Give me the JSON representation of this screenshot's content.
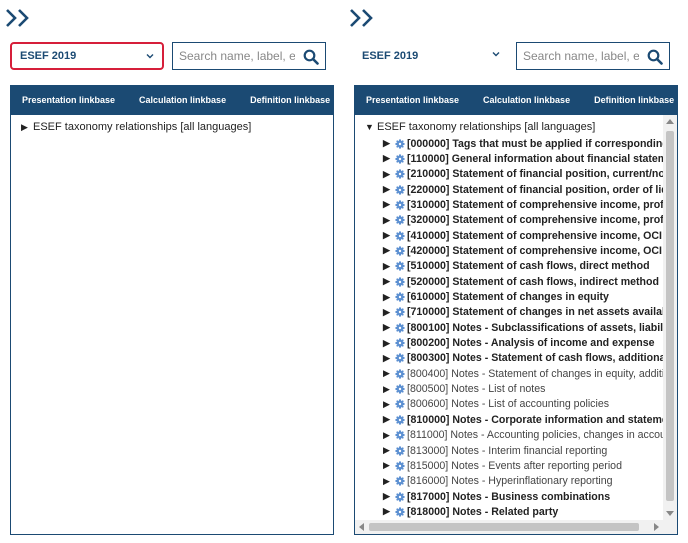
{
  "left_panel": {
    "select_value": "ESEF 2019",
    "search_placeholder": "Search name, label, etc.",
    "tabs": [
      "Presentation linkbase",
      "Calculation linkbase",
      "Definition linkbase"
    ],
    "root_label": "ESEF taxonomy relationships [all languages]"
  },
  "right_panel": {
    "select_value": "ESEF 2019",
    "search_placeholder": "Search name, label, etc.",
    "tabs": [
      "Presentation linkbase",
      "Calculation linkbase",
      "Definition linkbase"
    ],
    "root_label": "ESEF taxonomy relationships [all languages]",
    "nodes": [
      {
        "code": "[000000]",
        "label": "Tags that must be applied if corresponding in",
        "bold": true
      },
      {
        "code": "[110000]",
        "label": "General information about financial statemen",
        "bold": true
      },
      {
        "code": "[210000]",
        "label": "Statement of financial position, current/non-c",
        "bold": true
      },
      {
        "code": "[220000]",
        "label": "Statement of financial position, order of liquic",
        "bold": true
      },
      {
        "code": "[310000]",
        "label": "Statement of comprehensive income, profit o",
        "bold": true
      },
      {
        "code": "[320000]",
        "label": "Statement of comprehensive income, profit o",
        "bold": true
      },
      {
        "code": "[410000]",
        "label": "Statement of comprehensive income, OCI cor",
        "bold": true
      },
      {
        "code": "[420000]",
        "label": "Statement of comprehensive income, OCI cor",
        "bold": true
      },
      {
        "code": "[510000]",
        "label": "Statement of cash flows, direct method",
        "bold": true
      },
      {
        "code": "[520000]",
        "label": "Statement of cash flows, indirect method",
        "bold": true
      },
      {
        "code": "[610000]",
        "label": "Statement of changes in equity",
        "bold": true
      },
      {
        "code": "[710000]",
        "label": "Statement of changes in net assets available",
        "bold": true
      },
      {
        "code": "[800100]",
        "label": "Notes - Subclassifications of assets, liabilitie",
        "bold": true
      },
      {
        "code": "[800200]",
        "label": "Notes - Analysis of income and expense",
        "bold": true
      },
      {
        "code": "[800300]",
        "label": "Notes - Statement of cash flows, additional di",
        "bold": true
      },
      {
        "code": "[800400]",
        "label": "Notes - Statement of changes in equity, additiona",
        "bold": false
      },
      {
        "code": "[800500]",
        "label": "Notes - List of notes",
        "bold": false
      },
      {
        "code": "[800600]",
        "label": "Notes - List of accounting policies",
        "bold": false
      },
      {
        "code": "[810000]",
        "label": "Notes - Corporate information and statement",
        "bold": true
      },
      {
        "code": "[811000]",
        "label": "Notes - Accounting policies, changes in accountin",
        "bold": false
      },
      {
        "code": "[813000]",
        "label": "Notes - Interim financial reporting",
        "bold": false
      },
      {
        "code": "[815000]",
        "label": "Notes - Events after reporting period",
        "bold": false
      },
      {
        "code": "[816000]",
        "label": "Notes - Hyperinflationary reporting",
        "bold": false
      },
      {
        "code": "[817000]",
        "label": "Notes - Business combinations",
        "bold": true
      },
      {
        "code": "[818000]",
        "label": "Notes - Related party",
        "bold": true
      }
    ]
  },
  "colors": {
    "navy": "#1b4a73",
    "focus_red": "#d61f3a",
    "gear_blue": "#5b8fd1"
  },
  "icons": {
    "expand": "double-chevron-right-icon",
    "search": "magnifier-icon",
    "node": "gear-icon"
  }
}
